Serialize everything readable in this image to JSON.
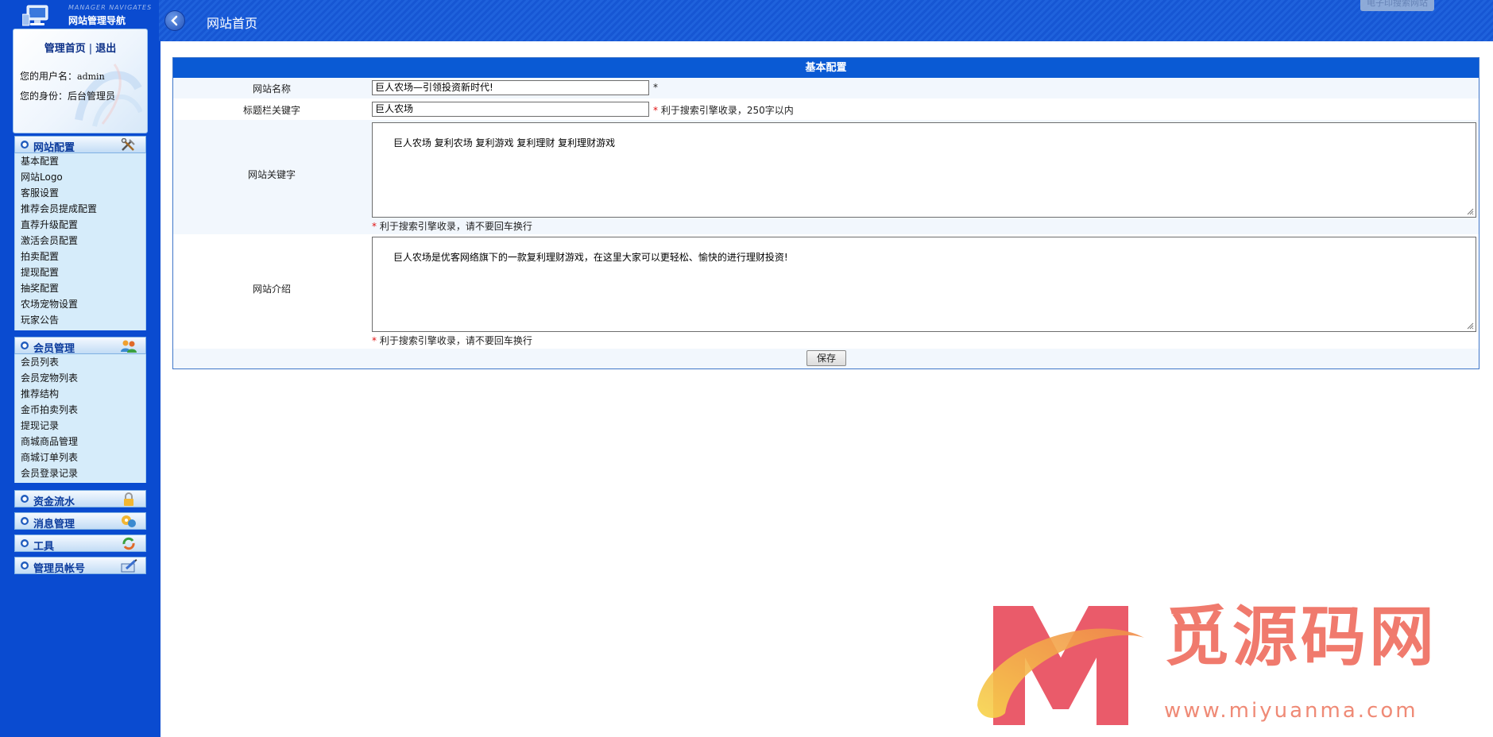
{
  "brand": {
    "en": "MANAGER NAVIGATES",
    "cn": "网站管理导航"
  },
  "userbox": {
    "home_link": "管理首页",
    "sep": "|",
    "logout_link": "退出",
    "username_label": "您的用户名：",
    "username": "admin",
    "role_label": "您的身份：",
    "role": "后台管理员"
  },
  "sidebar": {
    "groups": [
      {
        "title": "网站配置",
        "icon": "tools-icon",
        "items": [
          "基本配置",
          "网站Logo",
          "客服设置",
          "推荐会员提成配置",
          "直荐升级配置",
          "激活会员配置",
          "拍卖配置",
          "提现配置",
          "抽奖配置",
          "农场宠物设置",
          "玩家公告"
        ]
      },
      {
        "title": "会员管理",
        "icon": "users-icon",
        "items": [
          "会员列表",
          "会员宠物列表",
          "推荐结构",
          "金币拍卖列表",
          "提现记录",
          "商城商品管理",
          "商城订单列表",
          "会员登录记录"
        ]
      },
      {
        "title": "资金流水",
        "icon": "lock-icon",
        "items": []
      },
      {
        "title": "消息管理",
        "icon": "messages-icon",
        "items": []
      },
      {
        "title": "工具",
        "icon": "tools-refresh-icon",
        "items": []
      },
      {
        "title": "管理员帐号",
        "icon": "admin-account-icon",
        "items": []
      }
    ]
  },
  "header": {
    "title": "网站首页",
    "corner_text": "电子印搜索网站"
  },
  "form": {
    "title": "基本配置",
    "site_name": {
      "label": "网站名称",
      "value": "巨人农场—引领投资新时代!",
      "req": "*"
    },
    "title_keywords": {
      "label": "标题栏关键字",
      "value": "巨人农场",
      "req": "*",
      "hint": "利于搜索引擎收录，250字以内"
    },
    "site_keywords": {
      "label": "网站关键字",
      "value": "巨人农场 复利农场 复利游戏 复利理财 复利理财游戏",
      "req": "*",
      "hint": "利于搜索引擎收录，请不要回车换行"
    },
    "site_intro": {
      "label": "网站介绍",
      "value": "巨人农场是优客网络旗下的一款复利理财游戏，在这里大家可以更轻松、愉快的进行理财投资!",
      "req": "*",
      "hint": "利于搜索引擎收录，请不要回车换行"
    },
    "save_label": "保存"
  },
  "watermark": {
    "text": "觅源码网",
    "url": "www.miyuanma.com"
  },
  "colors": {
    "sidebar": "#0a4bd0",
    "panel_header": "#0a5ad4",
    "required": "#e01010",
    "watermark": "#f07a6d"
  }
}
